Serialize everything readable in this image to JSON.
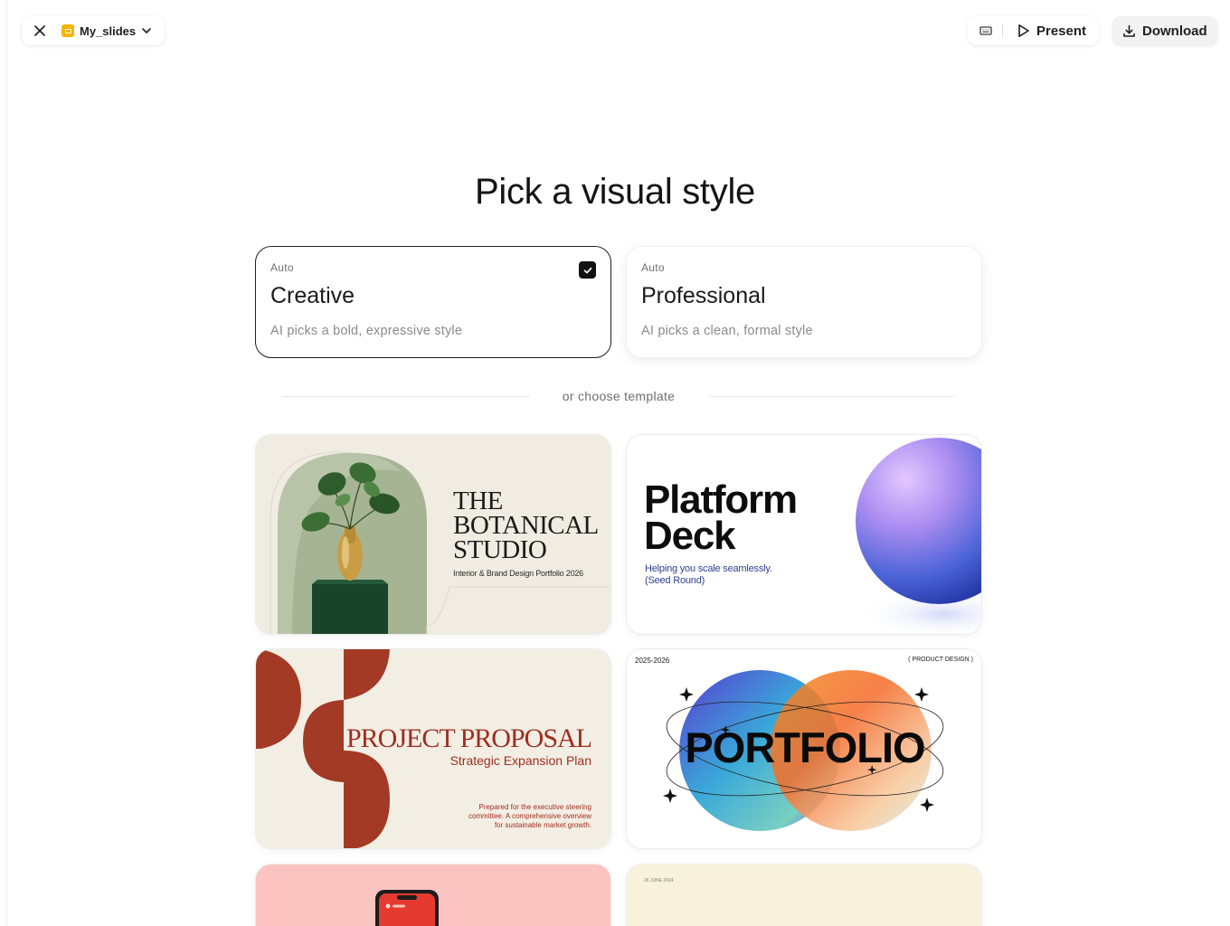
{
  "topbar": {
    "close_icon": "close-icon",
    "doc_icon": "slides-icon",
    "doc_title": "My_slides",
    "doc_dropdown_icon": "chevron-down-icon",
    "speaker_notes_icon": "keyboard-icon",
    "present_label": "Present",
    "download_label": "Download"
  },
  "heading": "Pick a visual style",
  "style_options": [
    {
      "tag": "Auto",
      "title": "Creative",
      "description": "AI picks a bold, expressive style",
      "selected": true
    },
    {
      "tag": "Auto",
      "title": "Professional",
      "description": "AI picks a clean, formal style",
      "selected": false
    }
  ],
  "divider_text": "or choose template",
  "templates": {
    "botanical": {
      "title_lines": [
        "THE",
        "BOTANICAL",
        "STUDIO"
      ],
      "subtitle": "Interior & Brand Design Portfolio 2026"
    },
    "platform": {
      "title_lines": [
        "Platform",
        "Deck"
      ],
      "subtitle_lines": [
        "Helping you scale seamlessly.",
        "(Seed Round)"
      ]
    },
    "proposal": {
      "title": "PROJECT PROPOSAL",
      "subtitle": "Strategic Expansion Plan",
      "note_lines": [
        "Prepared for the executive steering",
        "committee. A comprehensive overview",
        "for sustainable market growth."
      ]
    },
    "portfolio": {
      "year": "2025-2026",
      "tag": "( PRODUCT DESIGN )",
      "title": "PORTFOLIO"
    },
    "dated": {
      "date": "26 JUNE 2024"
    }
  },
  "colors": {
    "accent_dark": "#1f1f1f",
    "slides_icon": "#f4b400",
    "proposal_red": "#a33a25",
    "botanical_bg": "#f0ece2",
    "proposal_bg": "#f3eee3",
    "coral_bg": "#fbc4c0"
  }
}
